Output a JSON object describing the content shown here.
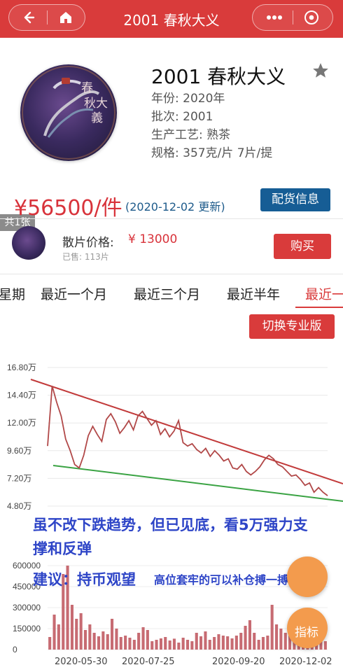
{
  "header": {
    "title": "2001 春秋大义",
    "back_icon": "back-arrow-icon",
    "home_icon": "home-icon",
    "more_icon": "more-icon",
    "target_icon": "target-icon",
    "accent": "#d93b3b"
  },
  "product": {
    "name": "2001 春秋大义",
    "year_label": "年份: 2020年",
    "batch_label": "批次: 2001",
    "process_label": "生产工艺: 熟茶",
    "spec_label": "规格: 357克/片 7片/提",
    "stack_badge": "共1张",
    "price": "¥56500/件",
    "updated": "(2020-12-02 更新)",
    "distribution_button": "配货信息",
    "seal_text_1": "春",
    "seal_text_2": "秋大",
    "seal_text_3": "義"
  },
  "loose": {
    "label": "散片价格:",
    "price": "¥ 13000",
    "sold": "已售: 113片",
    "buy_button": "购买"
  },
  "tabs": {
    "t0": "星期",
    "t1": "最近一个月",
    "t2": "最近三个月",
    "t3": "最近半年",
    "t4": "最近一"
  },
  "switch_button": "切换专业版",
  "chart_data": {
    "type": "line",
    "title": "",
    "ylabel": "",
    "yticks": [
      "16.80万",
      "14.40万",
      "12.00万",
      "9.60万",
      "7.20万",
      "4.80万"
    ],
    "volume_yticks": [
      "600000",
      "450000",
      "300000",
      "150000",
      "0"
    ],
    "x": [
      "2020-05-30",
      "2020-07-25",
      "2020-09-20",
      "2020-12-02"
    ],
    "series": [
      {
        "values": [
          [
            0,
            10.0
          ],
          [
            1,
            15.2
          ],
          [
            2,
            13.8
          ],
          [
            3,
            12.6
          ],
          [
            4,
            10.6
          ],
          [
            5,
            9.6
          ],
          [
            6,
            8.4
          ],
          [
            7,
            8.1
          ],
          [
            8,
            9.2
          ],
          [
            9,
            10.9
          ],
          [
            10,
            11.7
          ],
          [
            11,
            11.0
          ],
          [
            12,
            10.4
          ],
          [
            13,
            12.3
          ],
          [
            14,
            12.8
          ],
          [
            15,
            12.1
          ],
          [
            16,
            11.1
          ],
          [
            17,
            11.6
          ],
          [
            18,
            12.2
          ],
          [
            19,
            11.4
          ],
          [
            20,
            12.6
          ],
          [
            21,
            13.0
          ],
          [
            22,
            12.4
          ],
          [
            23,
            11.8
          ],
          [
            24,
            12.2
          ],
          [
            25,
            11.0
          ],
          [
            26,
            11.5
          ],
          [
            27,
            10.8
          ],
          [
            28,
            11.3
          ],
          [
            29,
            12.2
          ],
          [
            30,
            10.3
          ],
          [
            31,
            10.0
          ],
          [
            32,
            10.2
          ],
          [
            33,
            9.7
          ],
          [
            34,
            9.4
          ],
          [
            35,
            9.8
          ],
          [
            36,
            9.1
          ],
          [
            37,
            9.6
          ],
          [
            38,
            9.2
          ],
          [
            39,
            8.7
          ],
          [
            40,
            8.9
          ],
          [
            41,
            8.1
          ],
          [
            42,
            8.0
          ],
          [
            43,
            8.4
          ],
          [
            44,
            7.8
          ],
          [
            45,
            7.5
          ],
          [
            46,
            7.8
          ],
          [
            47,
            8.2
          ],
          [
            48,
            8.8
          ],
          [
            49,
            9.2
          ],
          [
            50,
            8.9
          ],
          [
            51,
            8.4
          ],
          [
            52,
            8.2
          ],
          [
            53,
            7.8
          ],
          [
            54,
            7.4
          ],
          [
            55,
            7.5
          ],
          [
            56,
            7.1
          ],
          [
            57,
            6.6
          ],
          [
            58,
            6.8
          ],
          [
            59,
            6.0
          ],
          [
            60,
            6.4
          ],
          [
            61,
            6.0
          ],
          [
            62,
            5.7
          ]
        ]
      }
    ],
    "volume": [
      90000,
      250000,
      180000,
      540000,
      600000,
      320000,
      220000,
      260000,
      140000,
      180000,
      120000,
      95000,
      130000,
      110000,
      220000,
      150000,
      90000,
      100000,
      85000,
      70000,
      120000,
      160000,
      140000,
      60000,
      70000,
      80000,
      90000,
      65000,
      78000,
      50000,
      85000,
      70000,
      60000,
      120000,
      95000,
      130000,
      70000,
      90000,
      110000,
      100000,
      95000,
      80000,
      100000,
      120000,
      170000,
      210000,
      120000,
      70000,
      90000,
      100000,
      320000,
      180000,
      150000,
      120000,
      140000,
      95000,
      110000,
      130000,
      90000,
      160000,
      80000,
      100000,
      60000
    ],
    "trend_upper_color": "#c23a3a",
    "trend_lower_color": "#3aa343",
    "line_color": "#b14848",
    "bar_color": "#c76b72"
  },
  "annotations": {
    "line1": "虽不改下跌趋势，但已见底，看5万强力支",
    "line2": "撑和反弹",
    "suggest_bold": "建议：持币观望",
    "suggest_small": "高位套牢的可以补仓搏一搏反弹",
    "fab_label": "指标"
  }
}
